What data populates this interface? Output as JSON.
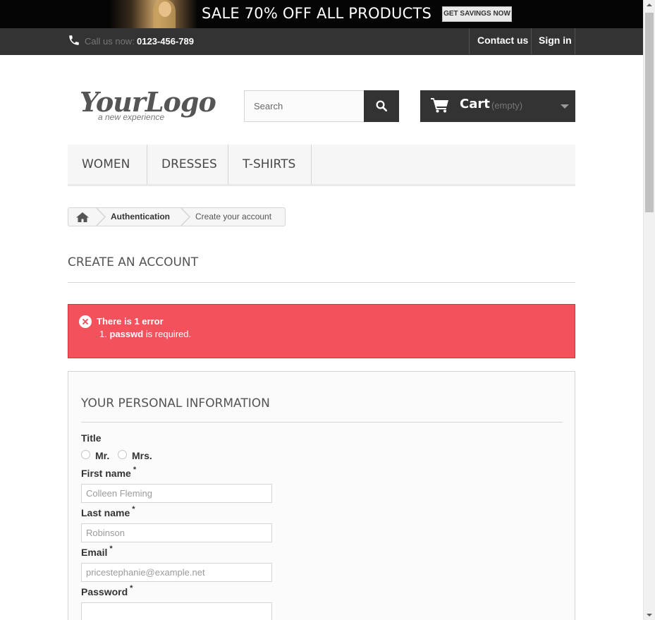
{
  "banner": {
    "promo_text": "SALE 70% OFF ALL PRODUCTS",
    "cta_label": "GET SAVINGS NOW"
  },
  "topnav": {
    "call_label": "Call us now:",
    "phone": "0123-456-789",
    "links": [
      "Contact us",
      "Sign in"
    ]
  },
  "header": {
    "logo_main": "YourLogo",
    "logo_sub": "a new experience",
    "search_placeholder": "Search",
    "cart_label": "Cart",
    "cart_status": "(empty)"
  },
  "menu": {
    "items": [
      "WOMEN",
      "DRESSES",
      "T-SHIRTS"
    ]
  },
  "breadcrumb": {
    "items": [
      "Authentication",
      "Create your account"
    ]
  },
  "page": {
    "heading": "CREATE AN ACCOUNT"
  },
  "error": {
    "title": "There is 1 error",
    "item_number": "1.",
    "item_field": "passwd",
    "item_text": "is required."
  },
  "form": {
    "section_title": "YOUR PERSONAL INFORMATION",
    "title_label": "Title",
    "title_options": [
      "Mr.",
      "Mrs."
    ],
    "first_name_label": "First name",
    "first_name_value": "Colleen Fleming",
    "last_name_label": "Last name",
    "last_name_value": "Robinson",
    "email_label": "Email",
    "email_value": "pricestephanie@example.net",
    "password_label": "Password",
    "password_value": "",
    "required_mark": "*"
  },
  "colors": {
    "dark_bar": "#333333",
    "error_bg": "#f3515c",
    "menu_bg": "#f6f6f6"
  }
}
